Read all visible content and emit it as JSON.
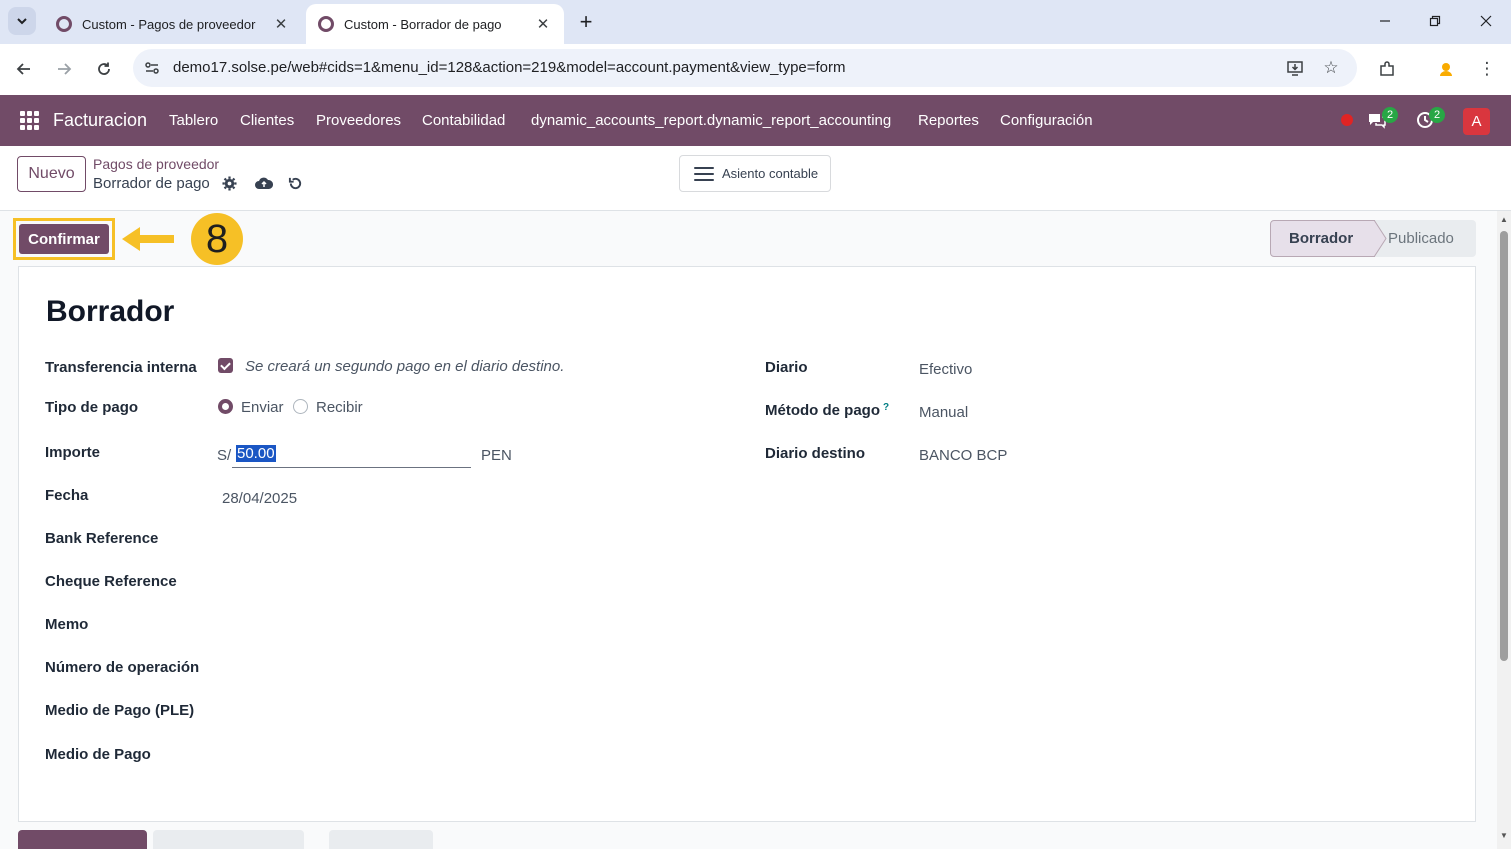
{
  "browser": {
    "tabs": [
      {
        "title": "Custom - Pagos de proveedor",
        "active": false
      },
      {
        "title": "Custom - Borrador de pago",
        "active": true
      }
    ],
    "url": "demo17.solse.pe/web#cids=1&menu_id=128&action=219&model=account.payment&view_type=form"
  },
  "navbar": {
    "brand": "Facturacion",
    "menu": [
      "Tablero",
      "Clientes",
      "Proveedores",
      "Contabilidad",
      "dynamic_accounts_report.dynamic_report_accounting",
      "Reportes",
      "Configuración"
    ],
    "messages_count": "2",
    "activities_count": "2",
    "avatar_letter": "A"
  },
  "control_panel": {
    "new_label": "Nuevo",
    "breadcrumb_parent": "Pagos de proveedor",
    "breadcrumb_current": "Borrador de pago",
    "asiento_label": "Asiento contable"
  },
  "annotation": {
    "step_number": "8",
    "color": "#f6c026"
  },
  "header": {
    "confirm_label": "Confirmar",
    "status_steps": [
      "Borrador",
      "Publicado"
    ]
  },
  "form": {
    "title": "Borrador",
    "left_fields": {
      "transferencia_label": "Transferencia interna",
      "transferencia_hint": "Se creará un segundo pago en el diario destino.",
      "tipo_label": "Tipo de pago",
      "tipo_enviar": "Enviar",
      "tipo_recibir": "Recibir",
      "importe_label": "Importe",
      "importe_symbol": "S/",
      "importe_value": "50.00",
      "importe_currency": "PEN",
      "fecha_label": "Fecha",
      "fecha_value": "28/04/2025",
      "bank_ref_label": "Bank Reference",
      "cheque_ref_label": "Cheque Reference",
      "memo_label": "Memo",
      "num_operacion_label": "Número de operación",
      "medio_ple_label": "Medio de Pago (PLE)",
      "medio_label": "Medio de Pago"
    },
    "right_fields": {
      "diario_label": "Diario",
      "diario_value": "Efectivo",
      "metodo_label": "Método de pago",
      "metodo_help": "?",
      "metodo_value": "Manual",
      "diario_destino_label": "Diario destino",
      "diario_destino_value": "BANCO BCP"
    }
  },
  "colors": {
    "brand": "#714b67",
    "highlight": "#f6c026"
  }
}
